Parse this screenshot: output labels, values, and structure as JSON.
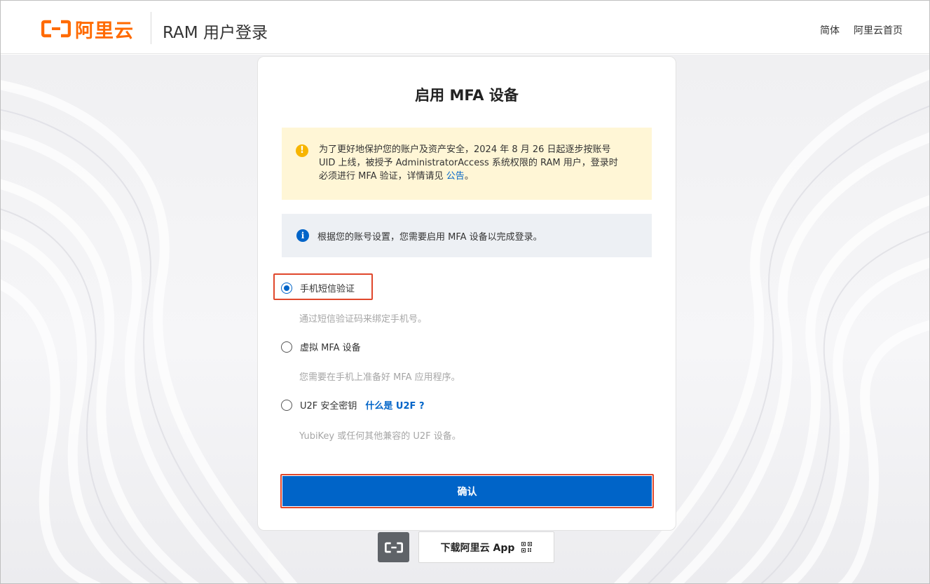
{
  "header": {
    "logo_text": "阿里云",
    "title": "RAM 用户登录",
    "links": [
      "简体",
      "阿里云首页"
    ]
  },
  "card": {
    "title": "启用 MFA 设备",
    "warning": {
      "text": "为了更好地保护您的账户及资产安全，2024 年 8 月 26 日起逐步按账号 UID 上线，被授予 AdministratorAccess 系统权限的 RAM 用户，登录时必须进行 MFA 验证，详情请见 ",
      "link": "公告",
      "suffix": "。"
    },
    "info": "根据您的账号设置，您需要启用 MFA 设备以完成登录。",
    "options": [
      {
        "label": "手机短信验证",
        "desc": "通过短信验证码来绑定手机号。",
        "checked": true
      },
      {
        "label": "虚拟 MFA 设备",
        "desc": "您需要在手机上准备好 MFA 应用程序。",
        "checked": false
      },
      {
        "label": "U2F 安全密钥",
        "extra_link": "什么是 U2F ?",
        "desc": "YubiKey 或任何其他兼容的 U2F 设备。",
        "checked": false
      }
    ],
    "confirm_label": "确认"
  },
  "app_download": {
    "label": "下载阿里云 App"
  },
  "colors": {
    "brand": "#ff6a00",
    "primary": "#0064c8",
    "highlight": "#e0472b",
    "warning_bg": "#fff6d6",
    "info_bg": "#edf0f4"
  }
}
